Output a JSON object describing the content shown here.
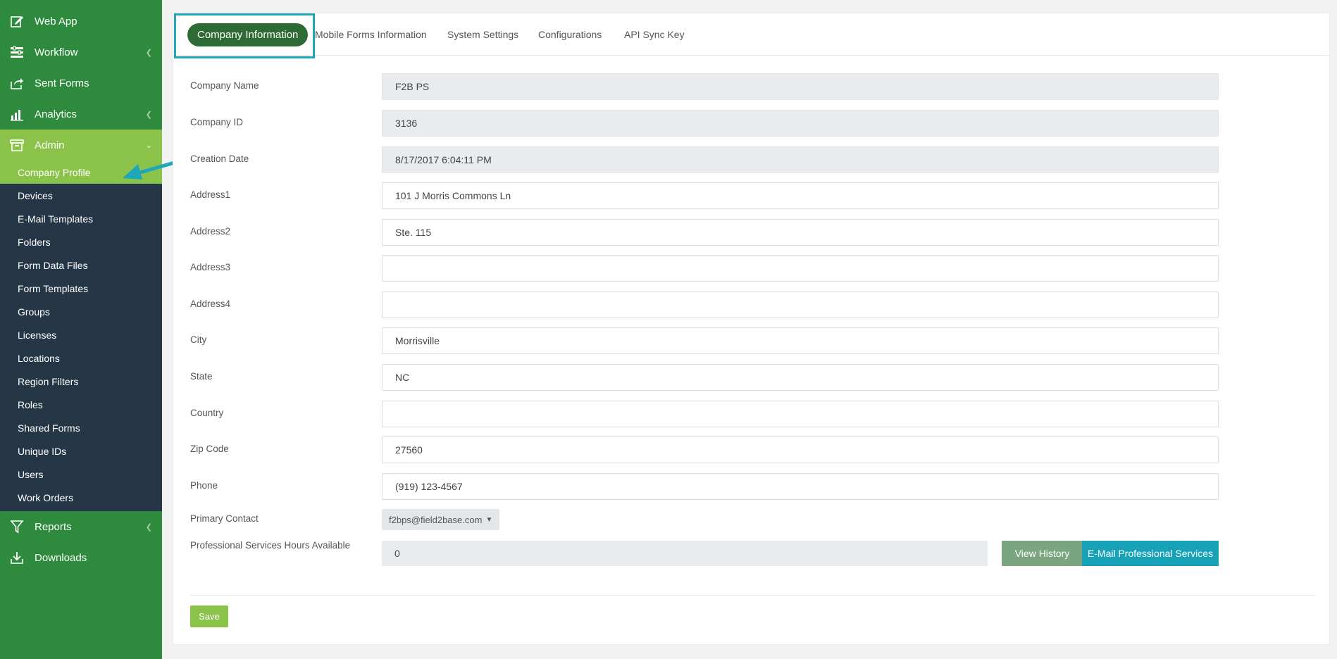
{
  "sidebar": {
    "nav_top": [
      {
        "label": "Web App",
        "icon": "edit-icon"
      },
      {
        "label": "Workflow",
        "icon": "workflow-icon"
      },
      {
        "label": "Sent Forms",
        "icon": "share-icon"
      },
      {
        "label": "Analytics",
        "icon": "bar-chart-icon"
      },
      {
        "label": "Admin",
        "icon": "archive-icon"
      }
    ],
    "admin_items": [
      "Company Profile",
      "Devices",
      "E-Mail Templates",
      "Folders",
      "Form Data Files",
      "Form Templates",
      "Groups",
      "Licenses",
      "Locations",
      "Region Filters",
      "Roles",
      "Shared Forms",
      "Unique IDs",
      "Users",
      "Work Orders"
    ],
    "nav_bottom": [
      {
        "label": "Reports",
        "icon": "filter-icon"
      },
      {
        "label": "Downloads",
        "icon": "download-icon"
      }
    ]
  },
  "tabs": {
    "active": "Company Information",
    "others": [
      "Mobile Forms Information",
      "System Settings",
      "Configurations",
      "API Sync Key"
    ]
  },
  "form": {
    "company_name": {
      "label": "Company Name",
      "value": "F2B PS"
    },
    "company_id": {
      "label": "Company ID",
      "value": "3136"
    },
    "creation_date": {
      "label": "Creation Date",
      "value": "8/17/2017 6:04:11 PM"
    },
    "address1": {
      "label": "Address1",
      "value": "101 J Morris Commons Ln"
    },
    "address2": {
      "label": "Address2",
      "value": "Ste. 115"
    },
    "address3": {
      "label": "Address3",
      "value": ""
    },
    "address4": {
      "label": "Address4",
      "value": ""
    },
    "city": {
      "label": "City",
      "value": "Morrisville"
    },
    "state": {
      "label": "State",
      "value": "NC"
    },
    "country": {
      "label": "Country",
      "value": ""
    },
    "zip": {
      "label": "Zip Code",
      "value": "27560"
    },
    "phone": {
      "label": "Phone",
      "value": "(919) 123-4567"
    },
    "primary_contact": {
      "label": "Primary Contact",
      "value": "f2bps@field2base.com"
    },
    "ps_hours": {
      "label": "Professional Services Hours Available",
      "value": "0"
    }
  },
  "buttons": {
    "view_history": "View History",
    "email_ps": "E-Mail Professional Services",
    "save": "Save"
  },
  "colors": {
    "sidebar": "#2e8b3e",
    "submenu": "#253746",
    "active": "#8bc34a",
    "tab_active": "#2e6b34",
    "teal": "#17a2b8"
  }
}
